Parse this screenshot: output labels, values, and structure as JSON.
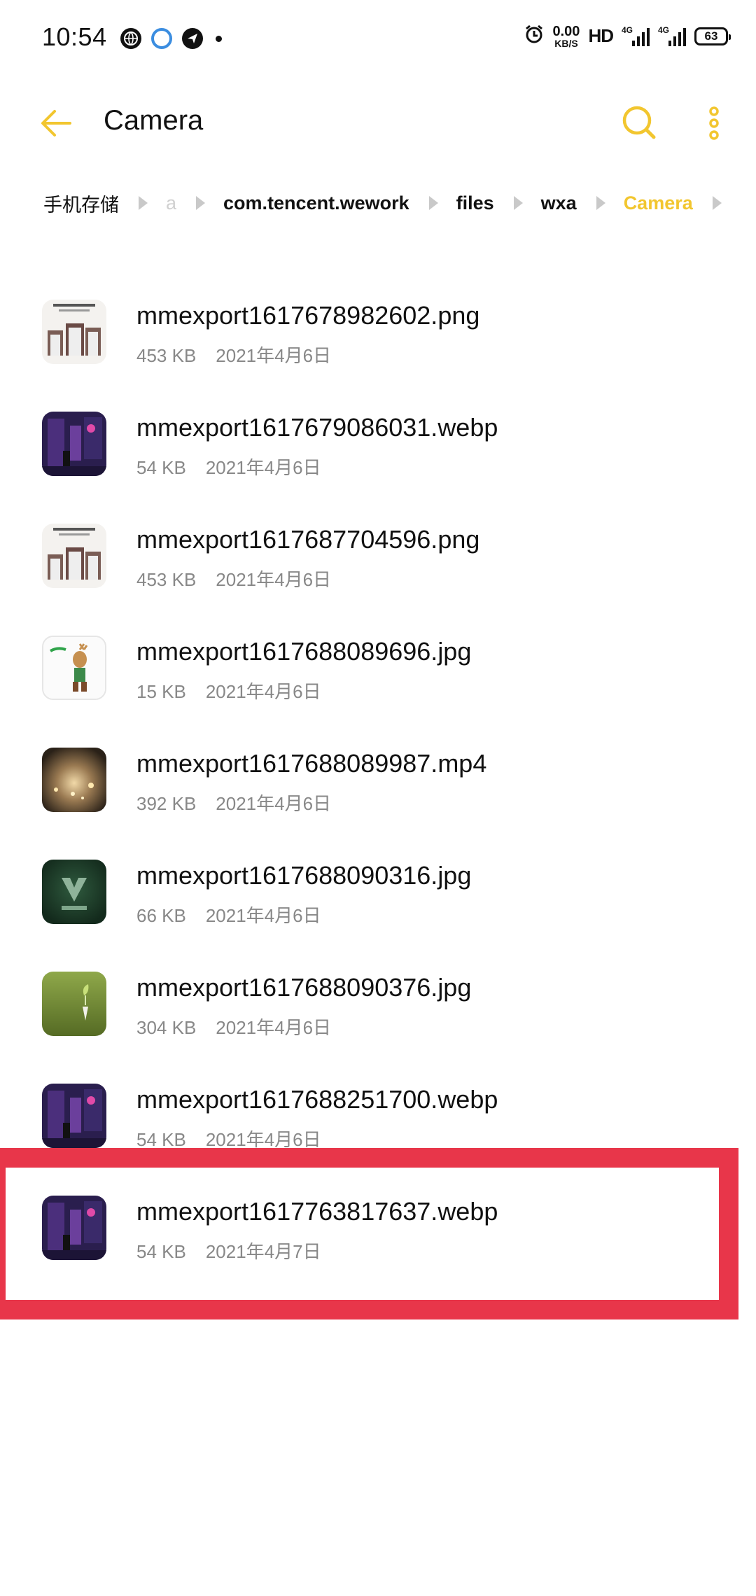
{
  "status_bar": {
    "time": "10:54",
    "net_speed_value": "0.00",
    "net_speed_unit": "KB/S",
    "hd_label": "HD",
    "signal1_label": "4G",
    "signal2_label": "4G",
    "battery": "63",
    "left_icons": [
      "globe-icon",
      "edge-browser-icon",
      "send-icon",
      "notification-dot-icon"
    ],
    "right_icons": [
      "alarm-icon"
    ]
  },
  "toolbar": {
    "title": "Camera",
    "back_icon": "arrow-left-icon",
    "search_icon": "search-icon",
    "more_icon": "more-vertical-icon",
    "accent_color": "#f2c62f"
  },
  "breadcrumb": [
    {
      "label": "手机存储",
      "style": "normal"
    },
    {
      "label": "a",
      "style": "faded"
    },
    {
      "label": "com.tencent.wework",
      "style": "bold"
    },
    {
      "label": "files",
      "style": "bold"
    },
    {
      "label": "wxa",
      "style": "bold"
    },
    {
      "label": "Camera",
      "style": "active"
    }
  ],
  "files": [
    {
      "name": "mmexport1617678982602.png",
      "size": "453 KB",
      "date": "2021年4月6日",
      "thumb": "image-thumbnail"
    },
    {
      "name": "mmexport1617679086031.webp",
      "size": "54 KB",
      "date": "2021年4月6日",
      "thumb": "image-thumbnail"
    },
    {
      "name": "mmexport1617687704596.png",
      "size": "453 KB",
      "date": "2021年4月6日",
      "thumb": "image-thumbnail"
    },
    {
      "name": "mmexport1617688089696.jpg",
      "size": "15 KB",
      "date": "2021年4月6日",
      "thumb": "image-thumbnail"
    },
    {
      "name": "mmexport1617688089987.mp4",
      "size": "392 KB",
      "date": "2021年4月6日",
      "thumb": "video-thumbnail"
    },
    {
      "name": "mmexport1617688090316.jpg",
      "size": "66 KB",
      "date": "2021年4月6日",
      "thumb": "image-thumbnail"
    },
    {
      "name": "mmexport1617688090376.jpg",
      "size": "304 KB",
      "date": "2021年4月6日",
      "thumb": "image-thumbnail"
    },
    {
      "name": "mmexport1617688251700.webp",
      "size": "54 KB",
      "date": "2021年4月6日",
      "thumb": "image-thumbnail"
    },
    {
      "name": "mmexport1617763817637.webp",
      "size": "54 KB",
      "date": "2021年4月7日",
      "thumb": "image-thumbnail"
    }
  ],
  "highlight_color": "#e8364a"
}
